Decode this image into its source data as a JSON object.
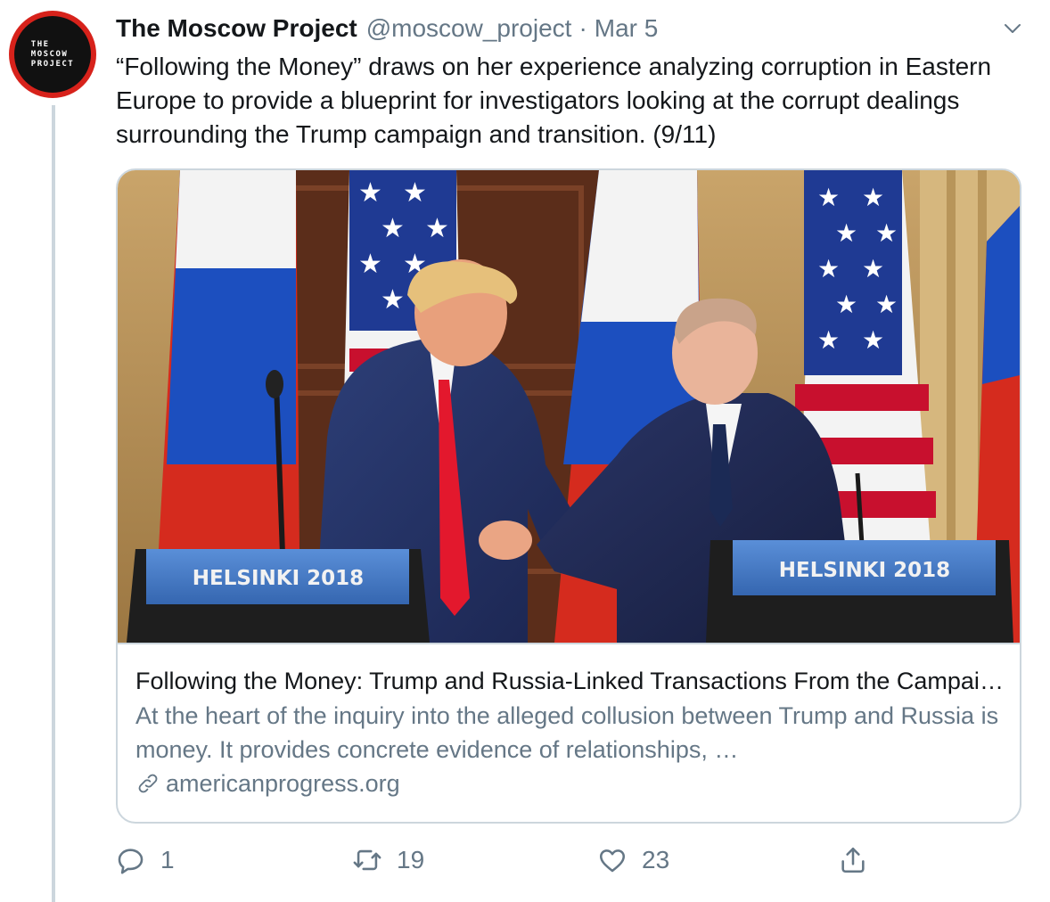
{
  "account": {
    "name": "The Moscow Project",
    "handle": "@moscow_project",
    "separator": "·",
    "date": "Mar 5",
    "avatar_text": "THE\nMOSCOW\nPROJECT"
  },
  "tweet": {
    "text": "“Following the Money” draws on her experience analyzing corruption in Eastern Europe to provide a blueprint for investigators looking at the corrupt dealings surrounding the Trump campaign and transition. (9/11)"
  },
  "card": {
    "title": "Following the Money: Trump and Russia-Linked Transactions From the Campaign to the Presidency",
    "description": "At the heart of the inquiry into the alleged collusion between Trump and Russia is money. It provides concrete evidence of relationships, …",
    "domain": "americanprogress.org",
    "image": {
      "podium_left": "HELSINKI 2018",
      "podium_right": "HELSINKI 2018"
    }
  },
  "actions": {
    "reply_count": "1",
    "retweet_count": "19",
    "like_count": "23"
  },
  "colors": {
    "text_primary": "#14171a",
    "text_secondary": "#657786",
    "border": "#ccd6dd",
    "avatar_ring": "#d7221b"
  },
  "icons": [
    "chevron-down-icon",
    "link-icon",
    "reply-icon",
    "retweet-icon",
    "like-icon",
    "share-icon"
  ]
}
